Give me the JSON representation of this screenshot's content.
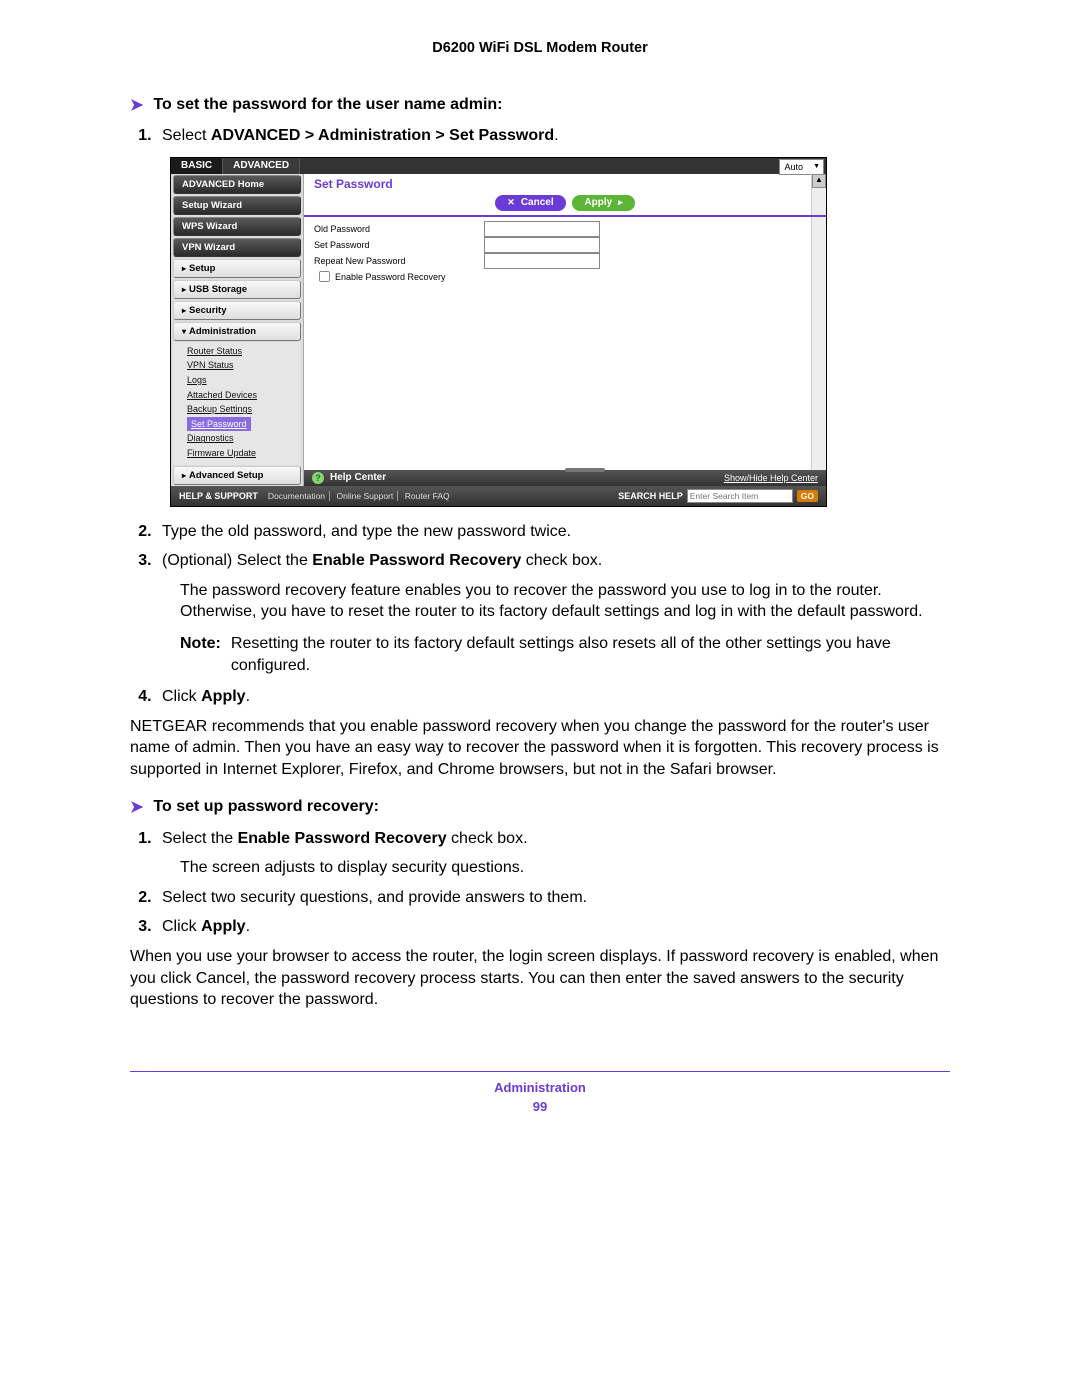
{
  "header": {
    "title": "D6200 WiFi DSL Modem Router"
  },
  "sections": {
    "proc1_title": "To set the password for the user name admin:",
    "step1_pre": "Select ",
    "step1_bold": "ADVANCED > Administration > Set Password",
    "step1_post": ".",
    "step2": "Type the old password, and type the new password twice.",
    "step3_pre": "(Optional) Select the ",
    "step3_bold": "Enable Password Recovery",
    "step3_post": " check box.",
    "para_recover": "The password recovery feature enables you to recover the password you use to log in to the router. Otherwise, you have to reset the router to its factory default settings and log in with the default password.",
    "note_label": "Note:",
    "note_text": "Resetting the router to its factory default settings also resets all of the other settings you have configured.",
    "step4_pre": "Click ",
    "step4_bold": "Apply",
    "step4_post": ".",
    "para_netgear": "NETGEAR recommends that you enable password recovery when you change the password for the router's user name of admin. Then you have an easy way to recover the password when it is forgotten. This recovery process is supported in Internet Explorer, Firefox, and Chrome browsers, but not in the Safari browser.",
    "proc2_title": "To set up password recovery:",
    "r_step1_pre": "Select the ",
    "r_step1_bold": "Enable Password Recovery",
    "r_step1_post": " check box.",
    "r_para1": "The screen adjusts to display security questions.",
    "r_step2": "Select two security questions, and provide answers to them.",
    "r_step3_pre": "Click ",
    "r_step3_bold": "Apply",
    "r_step3_post": ".",
    "r_para2": "When you use your browser to access the router, the login screen displays. If password recovery is enabled, when you click Cancel, the password recovery process starts. You can then enter the saved answers to the security questions to recover the password."
  },
  "footer": {
    "section_name": "Administration",
    "page_number": "99"
  },
  "ui": {
    "tabs": {
      "basic": "BASIC",
      "advanced": "ADVANCED"
    },
    "lang": "Auto",
    "sidebar": {
      "adv_home": "ADVANCED Home",
      "setup_wizard": "Setup Wizard",
      "wps_wizard": "WPS Wizard",
      "vpn_wizard": "VPN Wizard",
      "setup": "Setup",
      "usb": "USB Storage",
      "security": "Security",
      "administration": "Administration",
      "sub": {
        "router_status": "Router Status",
        "vpn_status": "VPN Status",
        "logs": "Logs",
        "attached": "Attached Devices",
        "backup": "Backup Settings",
        "set_password": "Set Password",
        "diagnostics": "Diagnostics",
        "fw_update": "Firmware Update"
      },
      "adv_setup": "Advanced Setup"
    },
    "main": {
      "title": "Set Password",
      "cancel": "Cancel",
      "apply": "Apply",
      "old_pw": "Old Password",
      "new_pw": "Set Password",
      "repeat_pw": "Repeat New Password",
      "enable_recovery": "Enable Password Recovery"
    },
    "help": {
      "label": "Help Center",
      "toggle": "Show/Hide Help Center"
    },
    "bottom": {
      "support_label": "HELP & SUPPORT",
      "doc": "Documentation",
      "online": "Online Support",
      "faq": "Router FAQ",
      "search_label": "SEARCH HELP",
      "search_placeholder": "Enter Search Item",
      "go": "GO"
    }
  }
}
